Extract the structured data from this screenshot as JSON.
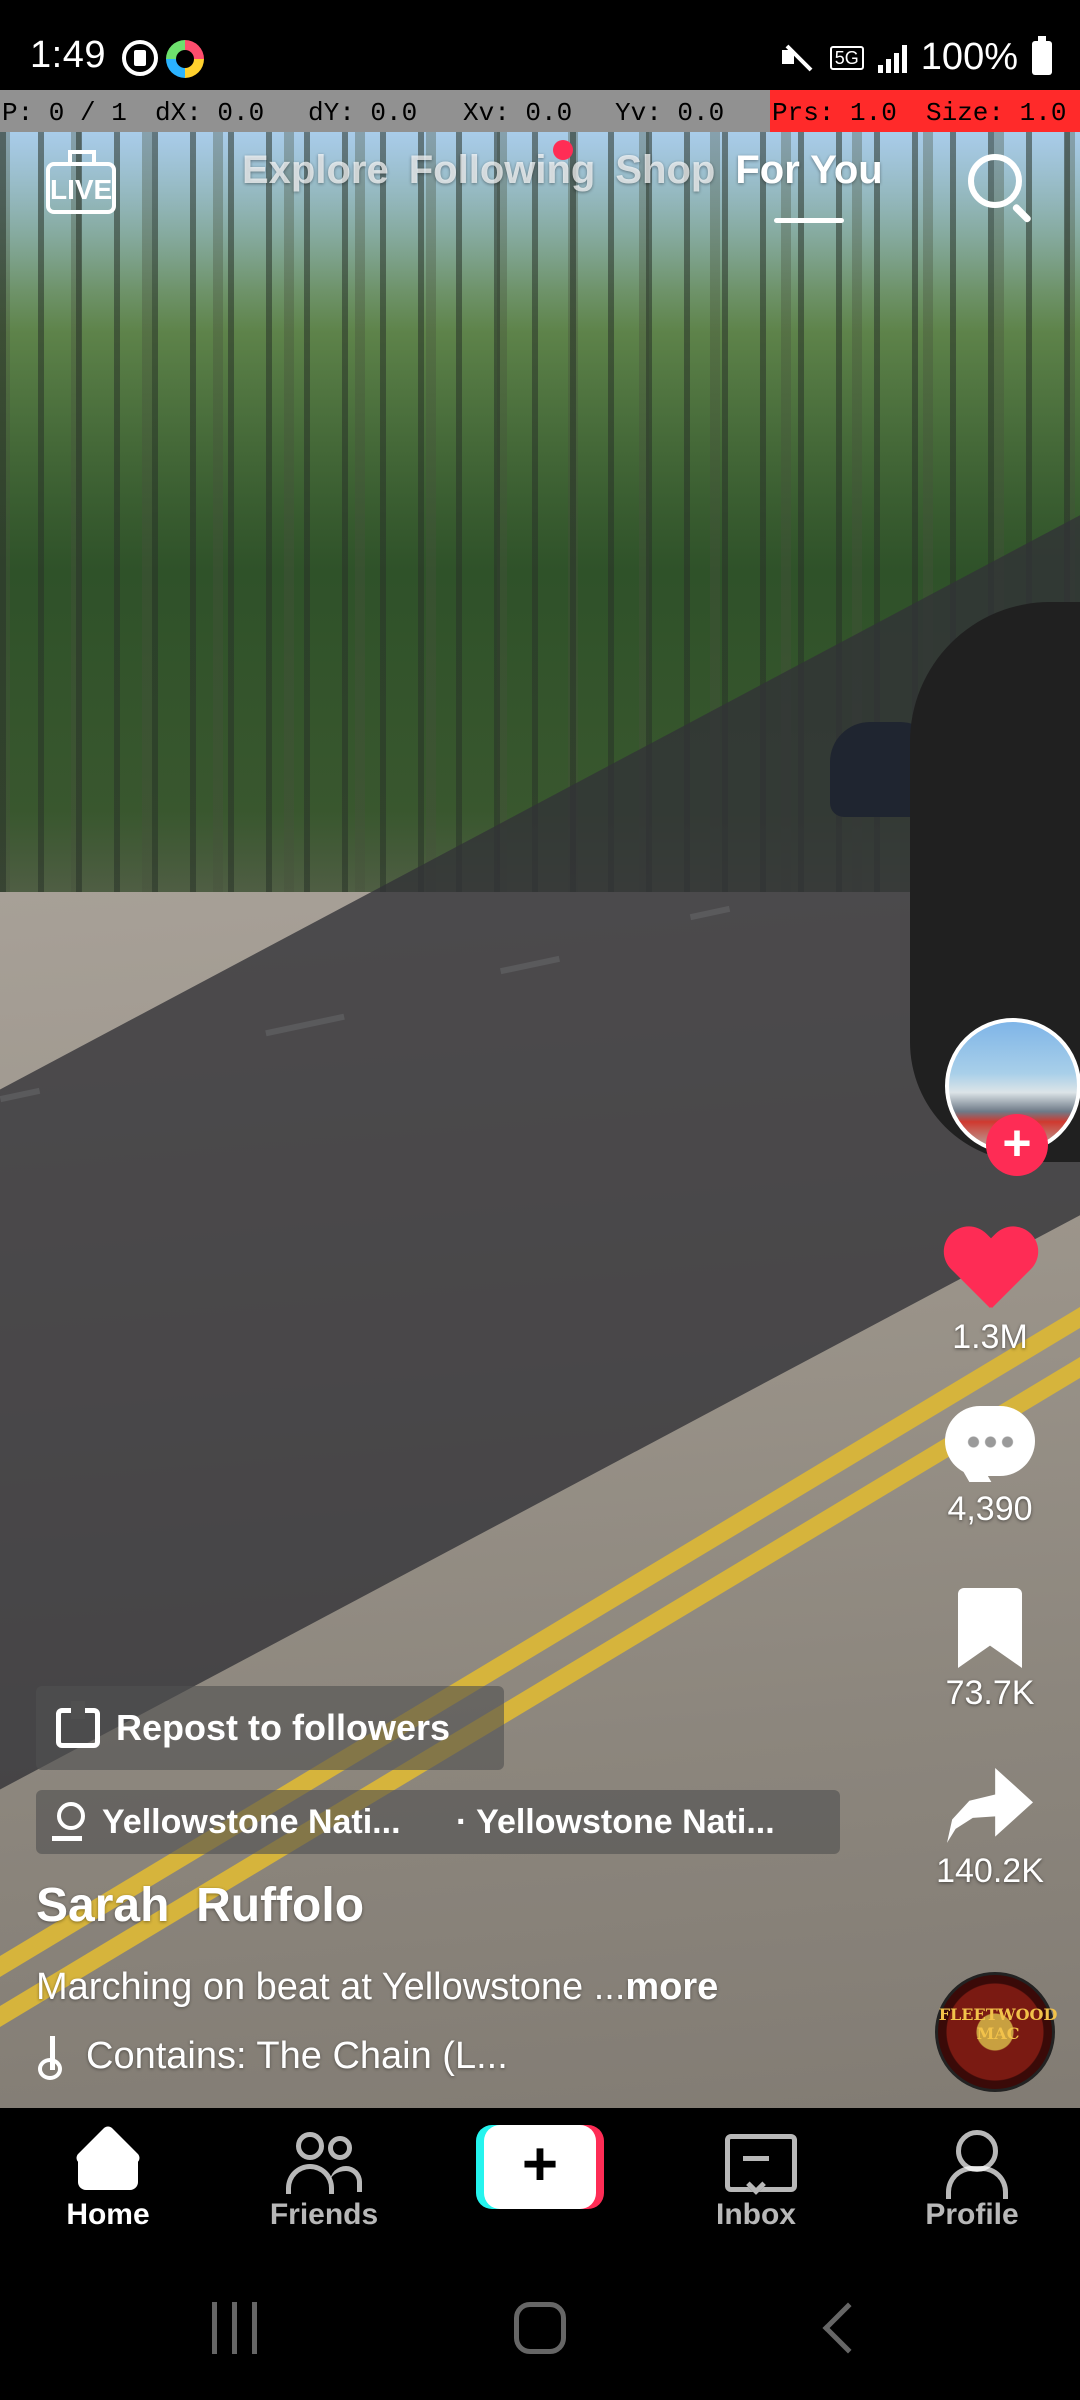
{
  "status_bar": {
    "time": "1:49",
    "network": "5G",
    "battery": "100%",
    "icons": [
      "app-notification-icon",
      "color-app-icon",
      "mute-icon",
      "5g-icon",
      "signal-icon",
      "battery-icon"
    ]
  },
  "debug_overlay": {
    "p": "P: 0 / 1",
    "dx": "dX: 0.0",
    "dy": "dY: 0.0",
    "xv": "Xv: 0.0",
    "yv": "Yv: 0.0",
    "prs": "Prs: 1.0",
    "size": "Size: 1.0"
  },
  "top_nav": {
    "live_label": "LIVE",
    "tabs": [
      {
        "label": "Explore",
        "active": false
      },
      {
        "label": "Following",
        "active": false,
        "has_dot": true
      },
      {
        "label": "Shop",
        "active": false
      },
      {
        "label": "For You",
        "active": true
      }
    ],
    "search_icon": "search-icon"
  },
  "video": {
    "actions": {
      "likes": "1.3M",
      "comments": "4,390",
      "bookmarks": "73.7K",
      "shares": "140.2K"
    },
    "follow_symbol": "+",
    "music_disc_text": "FLEETWOOD MAC",
    "repost_label": "Repost to followers",
    "locations": [
      "Yellowstone Nati...",
      "· Yellowstone Nati..."
    ],
    "username": "Sarah  Ruffolo",
    "caption": "Marching on beat at Yellowstone ...",
    "caption_more": "more",
    "sound": "Contains: The Chain (L..."
  },
  "bottom_nav": {
    "home": "Home",
    "friends": "Friends",
    "create_symbol": "+",
    "inbox": "Inbox",
    "profile": "Profile"
  },
  "colors": {
    "accent": "#fe2c55",
    "cyan": "#25f4ee",
    "background": "#000000"
  }
}
